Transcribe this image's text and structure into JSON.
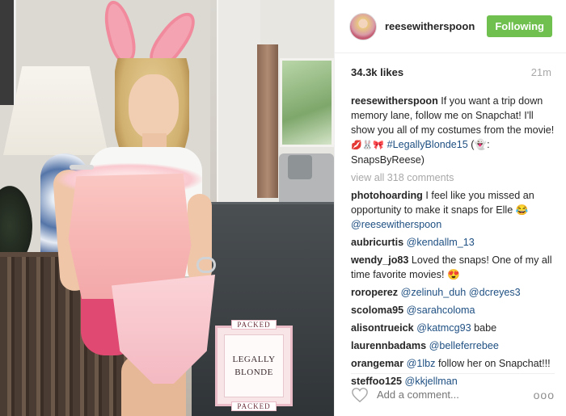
{
  "photo": {
    "sign": {
      "tag_top": "PACKED",
      "text": "LEGALLY\nBLONDE",
      "tag_bottom": "PACKED"
    }
  },
  "header": {
    "username": "reesewitherspoon",
    "follow_label": "Following",
    "follow_color": "#70c050"
  },
  "stats": {
    "likes": "34.3k likes",
    "age": "21m"
  },
  "caption": {
    "user": "reesewitherspoon",
    "text_before": "If you want a trip down memory lane, follow me on Snapchat! I'll show you all of my costumes from the movie! ",
    "emojis": "💋🐰🎀",
    "hashtag": "#LegallyBlonde15",
    "text_after": " (👻: SnapsByReese)"
  },
  "view_all": "view all 318 comments",
  "comments": [
    {
      "user": "photohoarding",
      "text_before": "I feel like you missed an opportunity to make it snaps for Elle 😂 ",
      "mention": "@reesewitherspoon",
      "text_after": ""
    },
    {
      "user": "aubricurtis",
      "text_before": "",
      "mention": "@kendallm_13",
      "text_after": ""
    },
    {
      "user": "wendy_jo83",
      "text_before": "Loved the snaps! One of my all time favorite movies! 😍",
      "mention": "",
      "text_after": ""
    },
    {
      "user": "roroperez",
      "text_before": "",
      "mention": "@zelinuh_duh @dcreyes3",
      "text_after": ""
    },
    {
      "user": "scoloma95",
      "text_before": "",
      "mention": "@sarahcoloma",
      "text_after": ""
    },
    {
      "user": "alisontrueick",
      "text_before": "",
      "mention": "@katmcg93",
      "text_after": " babe"
    },
    {
      "user": "laurennbadams",
      "text_before": "",
      "mention": "@belleferrebee",
      "text_after": ""
    },
    {
      "user": "orangemar",
      "text_before": "",
      "mention": "@1lbz",
      "text_after": " follow her on Snapchat!!!"
    },
    {
      "user": "steffoo125",
      "text_before": "",
      "mention": "@kkjellman",
      "text_after": ""
    }
  ],
  "footer": {
    "placeholder": "Add a comment...",
    "more": "ooo",
    "like_icon": "heart-outline-icon"
  },
  "colors": {
    "link": "#1e4f82",
    "muted": "#a8a8a8",
    "text": "#262626"
  }
}
